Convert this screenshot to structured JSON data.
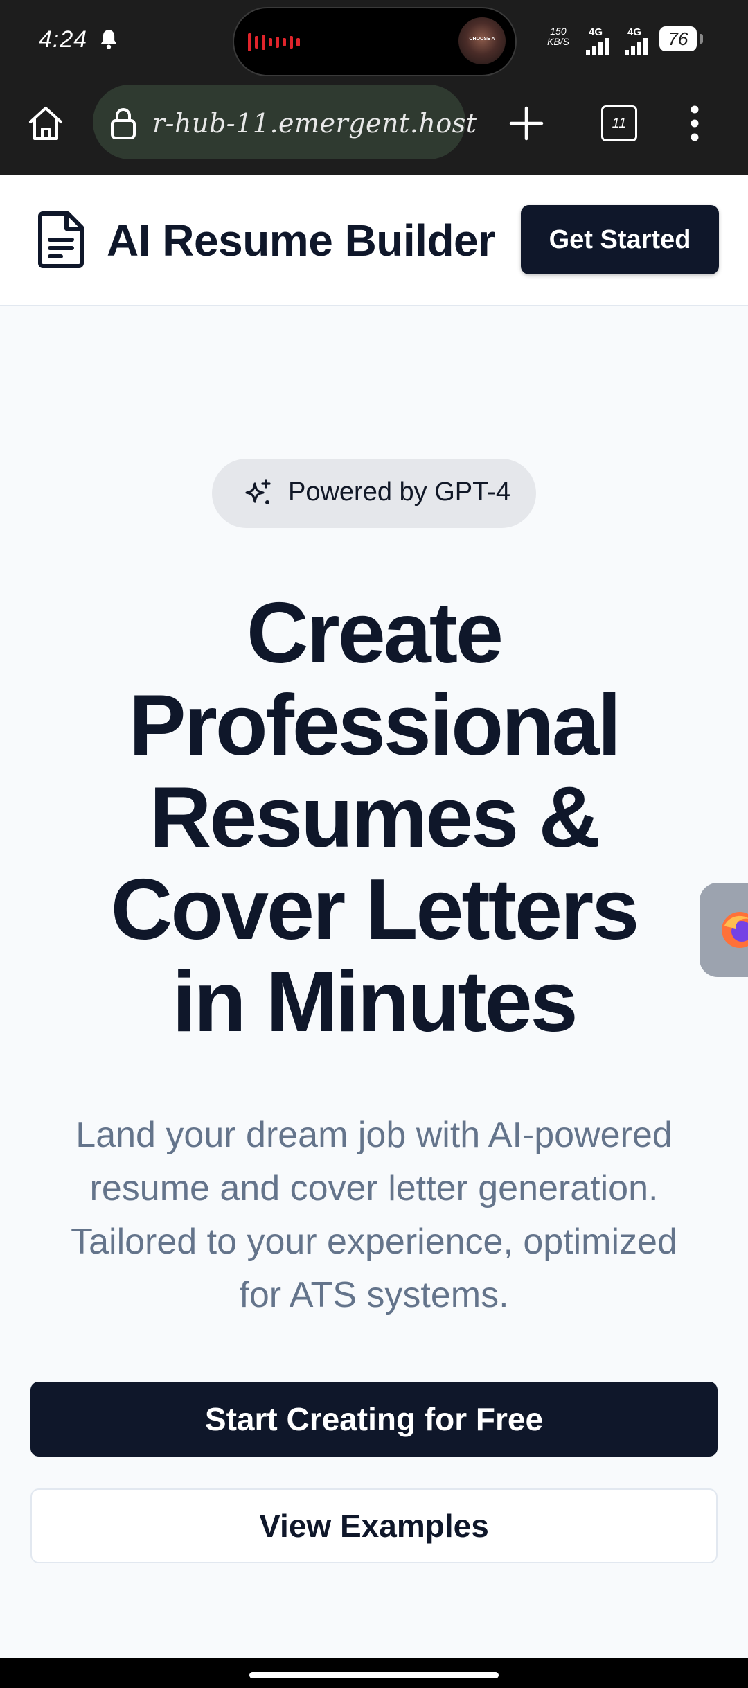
{
  "status_bar": {
    "time": "4:24",
    "island_thumb_text": "CHOOSE A",
    "net_speed_value": "150",
    "net_speed_unit": "KB/S",
    "sim1_network": "4G",
    "sim2_network": "4G",
    "battery": "76"
  },
  "browser": {
    "url": "r-hub-11.emergent.host",
    "tab_count": "11"
  },
  "header": {
    "brand": "AI Resume Builder",
    "get_started_label": "Get Started"
  },
  "hero": {
    "badge": "Powered by GPT-4",
    "title_lines": [
      "Create",
      "Professional",
      "Resumes &",
      "Cover Letters",
      "in Minutes"
    ],
    "subtitle_lines": [
      "Land your dream job with AI-powered",
      "resume and cover letter generation.",
      "Tailored to your experience, optimized",
      "for ATS systems."
    ],
    "primary_cta": "Start Creating for Free",
    "secondary_cta": "View Examples"
  },
  "colors": {
    "primary": "#0f172a",
    "background": "#f8fafc",
    "muted_text": "#64748b",
    "badge_bg": "#e5e7eb"
  },
  "icons": [
    "bell-icon",
    "wave-icon",
    "home-icon",
    "lock-icon",
    "plus-icon",
    "more-icon",
    "document-icon",
    "sparkle-icon",
    "firefox-icon"
  ]
}
